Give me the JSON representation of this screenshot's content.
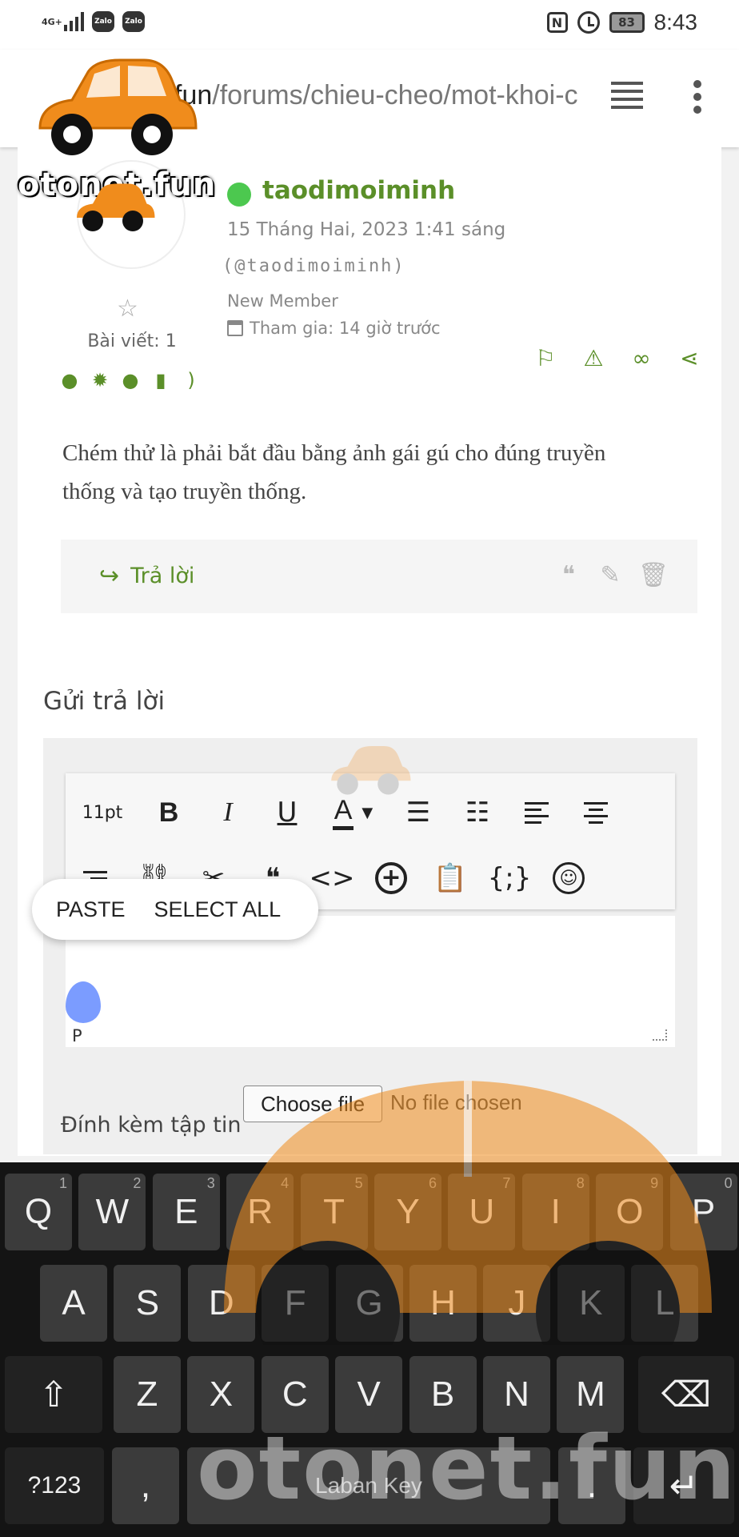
{
  "status_bar": {
    "network": "4G+",
    "apps": [
      "Zalo",
      "Zalo"
    ],
    "battery": "83",
    "time": "8:43"
  },
  "url_bar": {
    "host_fragment": "fun",
    "path": "/forums/chieu-cheo/mot-khoi-c"
  },
  "post": {
    "username": "taodimoiminh",
    "date": "15 Tháng Hai, 2023 1:41 sáng",
    "handle": "(@taodimoiminh)",
    "role": "New Member",
    "joined": "Tham gia: 14 giờ trước",
    "post_count": "Bài viết: 1",
    "body": "Chém thử là phải bắt đầu bằng ảnh gái gú cho đúng truyền thống và tạo truyền thống.",
    "reply_label": "Trả lời"
  },
  "reply_form": {
    "heading": "Gửi trả lời",
    "font_size": "11pt",
    "bold": "B",
    "italic": "I",
    "underline": "U",
    "text_color": "A",
    "code": "<>",
    "insert": "+",
    "code_block": "{;}",
    "paragraph_label": "P",
    "attach_label": "Đính kèm tập tin",
    "choose_file": "Choose file",
    "no_file": "No file chosen"
  },
  "context_menu": {
    "paste": "PASTE",
    "select_all": "SELECT ALL"
  },
  "keyboard": {
    "row1": [
      "Q",
      "W",
      "E",
      "R",
      "T",
      "Y",
      "U",
      "I",
      "O",
      "P"
    ],
    "row1_hints": [
      "1",
      "2",
      "3",
      "4",
      "5",
      "6",
      "7",
      "8",
      "9",
      "0"
    ],
    "row2": [
      "A",
      "S",
      "D",
      "F",
      "G",
      "H",
      "J",
      "K",
      "L"
    ],
    "row3": [
      "Z",
      "X",
      "C",
      "V",
      "B",
      "N",
      "M"
    ],
    "symbols": "?123",
    "comma": ",",
    "space": "Laban Key",
    "period": "."
  },
  "watermark": {
    "text": "otonet.fun"
  },
  "colors": {
    "accent_green": "#5b8f29",
    "online": "#4cc84f",
    "watermark_orange": "#f08c1c"
  }
}
